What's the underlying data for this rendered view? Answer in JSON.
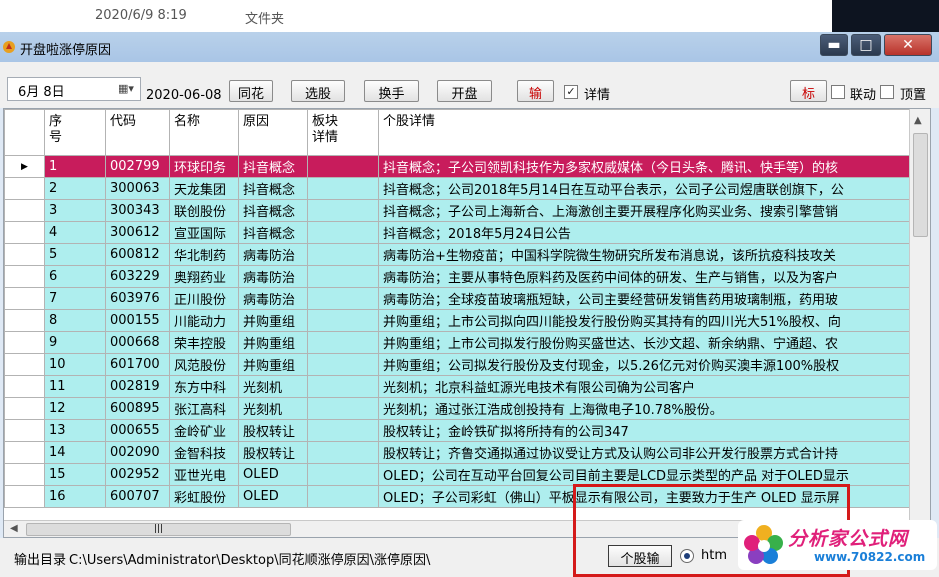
{
  "explorer": {
    "date": "2020/6/9 8:19",
    "type": "文件夹"
  },
  "window": {
    "title": "开盘啦涨停原因",
    "minimize_glyph": "▬",
    "maximize_glyph": "□",
    "close_glyph": "✕"
  },
  "toolbar": {
    "date_picker": "6月  8日",
    "calendar_glyph": "▦▾",
    "date_text": "2020-06-08",
    "buttons": [
      "同花",
      "选股",
      "换手",
      "开盘",
      "输"
    ],
    "detail_label": "详情",
    "detail_checked": true,
    "mark_button": "标",
    "linked_label": "联动",
    "top_label": "顶置"
  },
  "grid": {
    "columns": [
      "序\n号",
      "代码",
      "名称",
      "原因",
      "板块\n详情",
      "个股详情"
    ],
    "rows": [
      [
        "1",
        "002799",
        "环球印务",
        "抖音概念",
        "",
        "抖音概念；子公司领凯科技作为多家权威媒体（今日头条、腾讯、快手等）的核"
      ],
      [
        "2",
        "300063",
        "天龙集团",
        "抖音概念",
        "",
        "抖音概念；公司2018年5月14日在互动平台表示，公司子公司煜唐联创旗下，公"
      ],
      [
        "3",
        "300343",
        "联创股份",
        "抖音概念",
        "",
        "抖音概念；子公司上海新合、上海激创主要开展程序化购买业务、搜索引擎营销"
      ],
      [
        "4",
        "300612",
        "宣亚国际",
        "抖音概念",
        "",
        "抖音概念；2018年5月24日公告"
      ],
      [
        "5",
        "600812",
        "华北制药",
        "病毒防治",
        "",
        "病毒防治+生物疫苗；中国科学院微生物研究所发布消息说，该所抗疫科技攻关"
      ],
      [
        "6",
        "603229",
        "奥翔药业",
        "病毒防治",
        "",
        "病毒防治；主要从事特色原料药及医药中间体的研发、生产与销售，以及为客户"
      ],
      [
        "7",
        "603976",
        "正川股份",
        "病毒防治",
        "",
        "病毒防治；全球疫苗玻璃瓶短缺，公司主要经营研发销售药用玻璃制瓶，药用玻"
      ],
      [
        "8",
        "000155",
        "川能动力",
        "并购重组",
        "",
        "并购重组；上市公司拟向四川能投发行股份购买其持有的四川光大51%股权、向"
      ],
      [
        "9",
        "000668",
        "荣丰控股",
        "并购重组",
        "",
        "并购重组；上市公司拟发行股份购买盛世达、长沙文超、新余纳鼎、宁通超、农"
      ],
      [
        "10",
        "601700",
        "风范股份",
        "并购重组",
        "",
        "并购重组；公司拟发行股份及支付现金，以5.26亿元对价购买澳丰源100%股权"
      ],
      [
        "11",
        "002819",
        "东方中科",
        "光刻机",
        "",
        "光刻机；北京科益虹源光电技术有限公司确为公司客户"
      ],
      [
        "12",
        "600895",
        "张江高科",
        "光刻机",
        "",
        "光刻机；通过张江浩成创投持有 上海微电子10.78%股份。"
      ],
      [
        "13",
        "000655",
        "金岭矿业",
        "股权转让",
        "",
        "股权转让；金岭铁矿拟将所持有的公司347"
      ],
      [
        "14",
        "002090",
        "金智科技",
        "股权转让",
        "",
        "股权转让；齐鲁交通拟通过协议受让方式及认购公司非公开发行股票方式合计持"
      ],
      [
        "15",
        "002952",
        "亚世光电",
        "OLED",
        "",
        "OLED；公司在互动平台回复公司目前主要是LCD显示类型的产品 对于OLED显示"
      ],
      [
        "16",
        "600707",
        "彩虹股份",
        "OLED",
        "",
        "OLED；子公司彩虹（佛山）平板显示有限公司，主要致力于生产 OLED 显示屏"
      ]
    ],
    "selected_index": 0,
    "row_pointer_glyph": "▶",
    "scroll_up_glyph": "▲",
    "scroll_left_glyph": "◀",
    "hthumb_glyph": "|||"
  },
  "status": {
    "label": "输出目录",
    "path": "C:\\Users\\Administrator\\Desktop\\同花顺涨停原因\\涨停原因\\",
    "stock_button": "个股输",
    "radio_label": "htm"
  },
  "watermark": {
    "text": "分析家公式网",
    "url": "www.70822.com"
  },
  "colors": {
    "row_bg": "#aeeeee",
    "selected_bg": "#c81c5c",
    "highlight_border": "#d41a1a"
  }
}
